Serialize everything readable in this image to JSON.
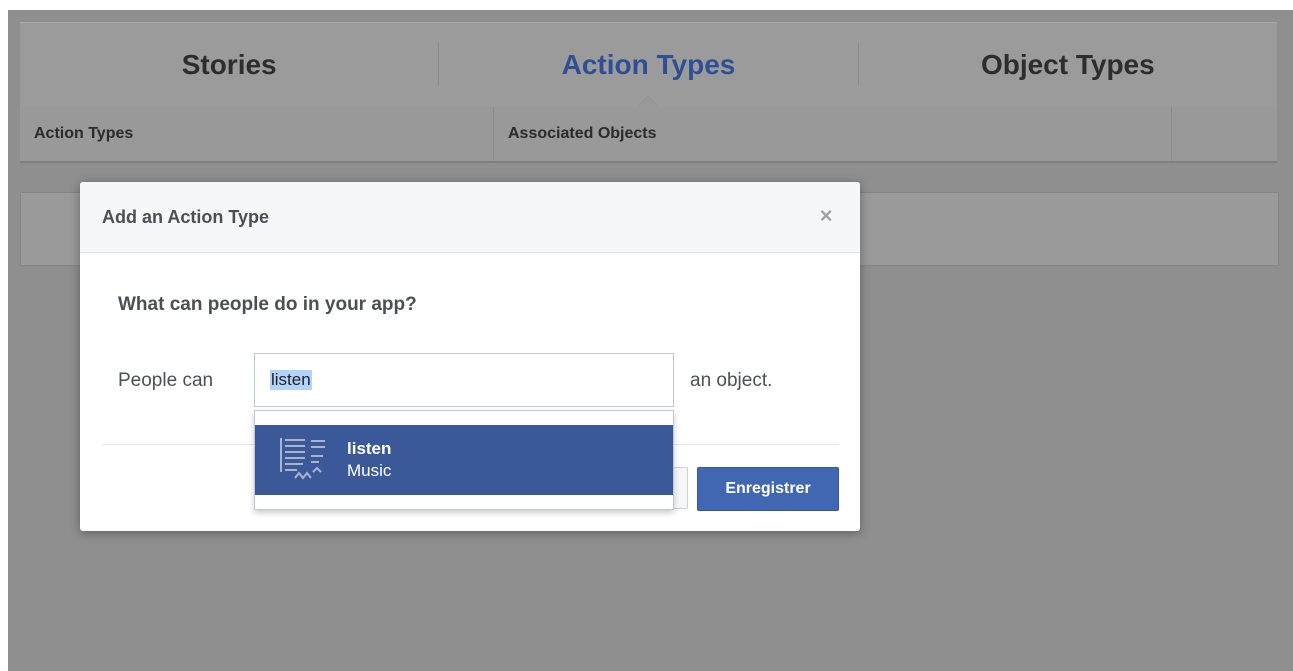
{
  "tabs": [
    {
      "label": "Stories"
    },
    {
      "label": "Action Types"
    },
    {
      "label": "Object Types"
    }
  ],
  "columns": {
    "action_types": "Action Types",
    "associated_objects": "Associated Objects"
  },
  "modal": {
    "title": "Add an Action Type",
    "close_symbol": "×",
    "question": "What can people do in your app?",
    "prefix": "People can",
    "input_value": "listen",
    "suffix": "an object.",
    "save_label": "Enregistrer"
  },
  "dropdown": {
    "items": [
      {
        "title": "listen",
        "subtitle": "Music",
        "icon": "music-list-icon"
      }
    ]
  },
  "colors": {
    "accent": "#3b5998",
    "button": "#4267b2",
    "active_tab": "#2f4f94",
    "overlay": "#8f8f8f"
  }
}
